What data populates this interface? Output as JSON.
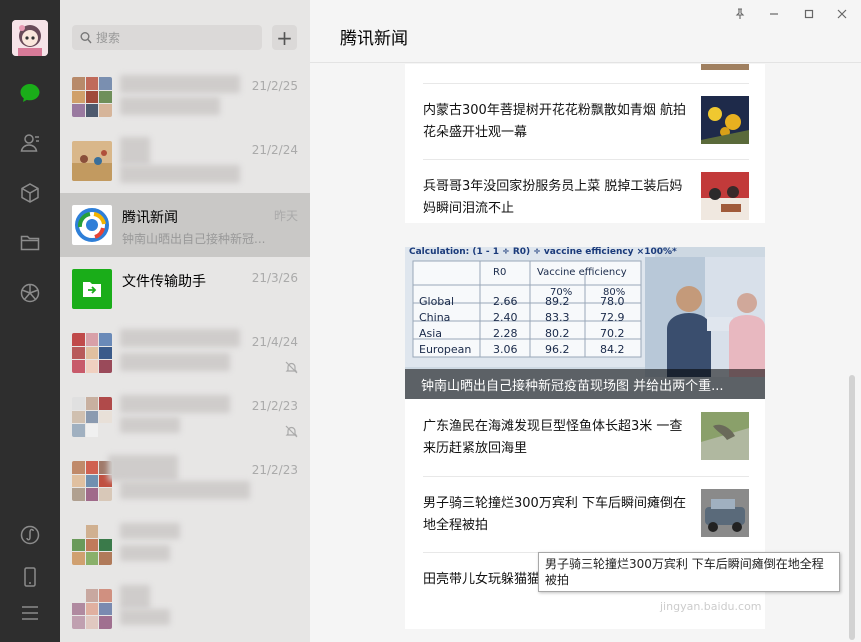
{
  "sidebar": {
    "icons": [
      "chat-icon",
      "contacts-icon",
      "favorites-icon",
      "files-icon",
      "moments-icon",
      "miniprogram-icon",
      "phone-icon",
      "menu-icon"
    ]
  },
  "search": {
    "placeholder": "搜索",
    "add_label": "+"
  },
  "chats": [
    {
      "name": "",
      "time": "21/2/25",
      "preview": ""
    },
    {
      "name": "",
      "time": "21/2/24",
      "preview": ""
    },
    {
      "name": "腾讯新闻",
      "time": "昨天",
      "preview": "钟南山晒出自己接种新冠..."
    },
    {
      "name": "文件传输助手",
      "time": "21/3/26",
      "preview": ""
    },
    {
      "name": "",
      "time": "21/4/24",
      "preview": ""
    },
    {
      "name": "",
      "time": "21/2/23",
      "preview": ""
    },
    {
      "name": "",
      "time": "21/2/23",
      "preview": ""
    },
    {
      "name": "",
      "time": "",
      "preview": ""
    },
    {
      "name": "",
      "time": "",
      "preview": ""
    }
  ],
  "main": {
    "title": "腾讯新闻",
    "window_controls": [
      "pin-icon",
      "minimize-icon",
      "maximize-icon",
      "close-icon"
    ]
  },
  "news_top": [
    {
      "text": "内蒙古300年菩提树开花花粉飘散如青烟 航拍花朵盛开壮观一幕"
    },
    {
      "text": "兵哥哥3年没回家扮服务员上菜 脱掉工装后妈妈瞬间泪流不止"
    }
  ],
  "hero": {
    "caption": "钟南山晒出自己接种新冠疫苗现场图 并给出两个重...",
    "table": {
      "formula": "Calculation: (1 - 1 ÷ R0) ÷ vaccine efficiency ×100%*",
      "headers": [
        "R0",
        "Vaccine efficiency"
      ],
      "sub_headers": [
        "70%",
        "80%"
      ],
      "rows": [
        [
          "Global",
          "2.66",
          "89.2",
          "78.0"
        ],
        [
          "China",
          "2.40",
          "83.3",
          "72.9"
        ],
        [
          "Asia",
          "2.28",
          "80.2",
          "70.2"
        ],
        [
          "European",
          "3.06",
          "96.2",
          "84.2"
        ]
      ]
    }
  },
  "news_bottom": [
    {
      "text": "广东渔民在海滩发现巨型怪鱼体长超3米 一查来历赶紧放回海里"
    },
    {
      "text": "男子骑三轮撞烂300万宾利 下车后瞬间瘫倒在地全程被拍"
    },
    {
      "text": "田亮带儿女玩躲猫猫 爸爸矮半头"
    }
  ],
  "tooltip": {
    "text": "男子骑三轮撞烂300万宾利 下车后瞬间瘫倒在地全程被拍"
  },
  "watermark": "jingyan.baidu.com",
  "colors": {
    "rail": "#2e2e2e",
    "list": "#e7e6e5",
    "active": "#c9c8c6",
    "accent": "#1aad19"
  }
}
